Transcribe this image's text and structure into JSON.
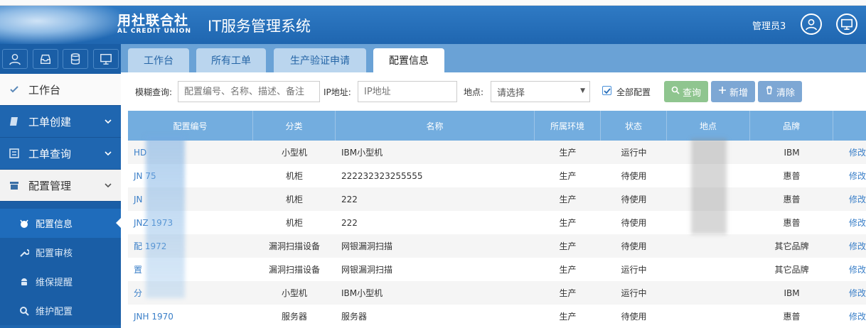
{
  "header": {
    "brand": "用社联合社",
    "brand_sub": "AL CREDIT UNION",
    "title": "IT服务管理系统",
    "admin_name": "管理员3",
    "user_icon": "user-icon",
    "screen_icon": "monitor-icon"
  },
  "sidebar": {
    "top_icons": [
      "user-icon",
      "inbox-icon",
      "database-icon",
      "monitor-icon"
    ],
    "items": [
      {
        "label": "工作台",
        "icon": "check-icon"
      },
      {
        "label": "工单创建",
        "icon": "book-icon"
      },
      {
        "label": "工单查询",
        "icon": "list-icon"
      },
      {
        "label": "配置管理",
        "icon": "box-icon"
      }
    ],
    "sub_items": [
      {
        "label": "配置信息",
        "icon": "github-icon"
      },
      {
        "label": "配置审核",
        "icon": "wrench-icon"
      },
      {
        "label": "维保提醒",
        "icon": "android-icon"
      },
      {
        "label": "维护配置",
        "icon": "search-icon"
      }
    ]
  },
  "tabs": [
    {
      "label": "工作台"
    },
    {
      "label": "所有工单"
    },
    {
      "label": "生产验证申请"
    },
    {
      "label": "配置信息"
    }
  ],
  "filter": {
    "fuzzy_label": "模糊查询:",
    "fuzzy_placeholder": "配置编号、名称、描述、备注",
    "ip_label": "IP地址:",
    "ip_placeholder": "IP地址",
    "location_label": "地点:",
    "location_value": "请选择",
    "all_config_label": "全部配置",
    "all_config_checked": true,
    "query_button": "查询",
    "add_button": "新增",
    "clear_button": "清除"
  },
  "table": {
    "headers": [
      "配置编号",
      "分类",
      "名称",
      "所属环境",
      "状态",
      "地点",
      "品牌",
      ""
    ],
    "rows": [
      {
        "code": "HD",
        "category": "小型机",
        "name": "IBM小型机",
        "env": "生产",
        "status": "运行中",
        "location": "",
        "brand": "IBM",
        "op": "修改"
      },
      {
        "code": "JN      75",
        "category": "机柜",
        "name": "222232323255555",
        "env": "生产",
        "status": "待使用",
        "location": "",
        "brand": "惠普",
        "op": "修改"
      },
      {
        "code": "JN",
        "category": "机柜",
        "name": "222",
        "env": "生产",
        "status": "待使用",
        "location": "",
        "brand": "惠普",
        "op": "修改"
      },
      {
        "code": "JNZ     1973",
        "category": "机柜",
        "name": "222",
        "env": "生产",
        "status": "待使用",
        "location": "",
        "brand": "惠普",
        "op": "修改"
      },
      {
        "code": "配        1972",
        "category": "漏洞扫描设备",
        "name": "网银漏洞扫描",
        "env": "生产",
        "status": "待使用",
        "location": "",
        "brand": "其它品牌",
        "op": "修改"
      },
      {
        "code": "置",
        "category": "漏洞扫描设备",
        "name": "网银漏洞扫描",
        "env": "生产",
        "status": "运行中",
        "location": "",
        "brand": "其它品牌",
        "op": "修改"
      },
      {
        "code": "分",
        "category": "小型机",
        "name": "IBM小型机",
        "env": "生产",
        "status": "运行中",
        "location": "",
        "brand": "IBM",
        "op": "修改"
      },
      {
        "code": "JNH      1970",
        "category": "服务器",
        "name": "服务器",
        "env": "生产",
        "status": "待使用",
        "location": "",
        "brand": "惠普",
        "op": "修改"
      }
    ]
  },
  "colors": {
    "header_blue": "#1f66b0",
    "tab_bar": "#6aa2d6",
    "table_head": "#73addf",
    "query_green": "#8fc58f",
    "action_blue": "#7da7d4",
    "link_blue": "#3a7fc8"
  }
}
